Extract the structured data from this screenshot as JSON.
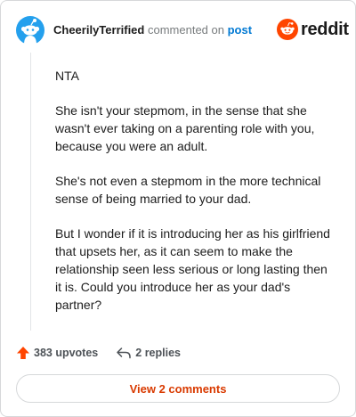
{
  "header": {
    "username": "CheerilyTerrified",
    "action_text": "commented on",
    "post_link": "post",
    "avatar_icon": "reddit-snoo-avatar-icon",
    "brand_icon": "reddit-logo-icon",
    "brand_text": "reddit"
  },
  "comment": {
    "paragraphs": [
      "NTA",
      "She isn't your stepmom, in the sense that she wasn't ever taking on a parenting role with you, because you were an adult.",
      "She's not even a stepmom in the more technical sense of being married to your dad.",
      "But I wonder if it is introducing her as his girlfriend that upsets her, as it can seem to make the relationship seen less serious or long lasting then it is. Could you introduce her as your dad's partner?"
    ]
  },
  "actions": {
    "upvotes_label": "383 upvotes",
    "upvote_icon": "upvote-arrow-icon",
    "replies_label": "2 replies",
    "reply_icon": "reply-arrow-icon"
  },
  "footer": {
    "view_comments_label": "View 2 comments"
  },
  "colors": {
    "brand_orange": "#ff4500",
    "upvote_orange": "#ff4500",
    "link_blue": "#0079d3",
    "view_button_text": "#d93a00",
    "avatar_bg": "#24a0ed"
  }
}
